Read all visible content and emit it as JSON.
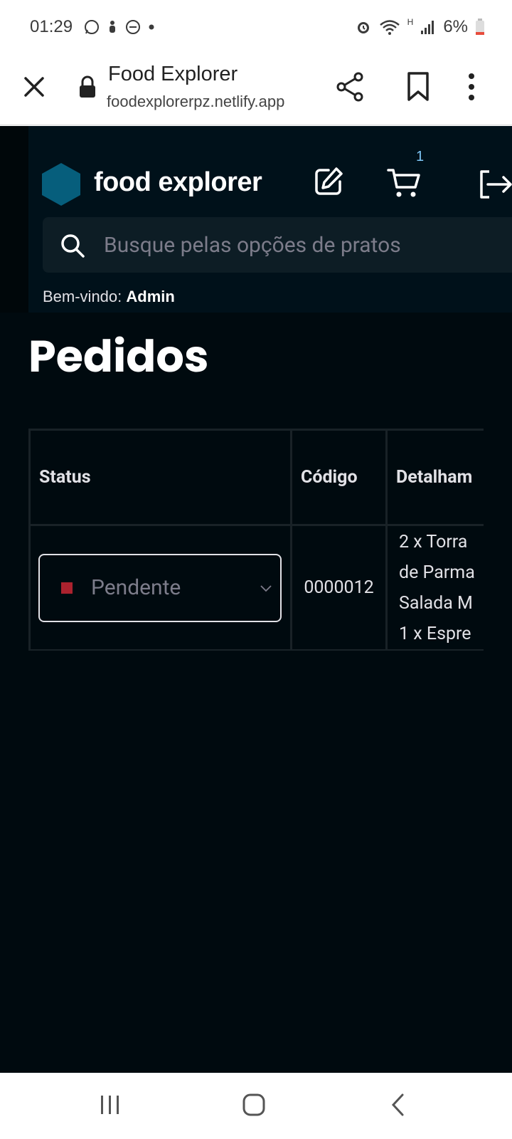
{
  "status_bar": {
    "time": "01:29",
    "battery": "6%",
    "network": "H"
  },
  "browser": {
    "title": "Food Explorer",
    "url": "foodexplorerpz.netlify.app"
  },
  "header": {
    "brand": "food explorer",
    "cart_count": "1",
    "search_placeholder": "Busque pelas opções de pratos",
    "welcome_prefix": "Bem-vindo:",
    "welcome_user": "Admin"
  },
  "page": {
    "title": "Pedidos"
  },
  "orders_table": {
    "headers": {
      "status": "Status",
      "code": "Código",
      "details": "Detalham"
    },
    "rows": [
      {
        "status": "Pendente",
        "code": "0000012",
        "details": [
          "2 x Torra",
          "de Parma",
          "Salada M",
          "1 x Espre"
        ]
      }
    ]
  },
  "colors": {
    "page_bg": "#000a0f",
    "header_bg": "#00111a",
    "accent_hex": "#065e7c",
    "pending_status": "#ab222e"
  }
}
